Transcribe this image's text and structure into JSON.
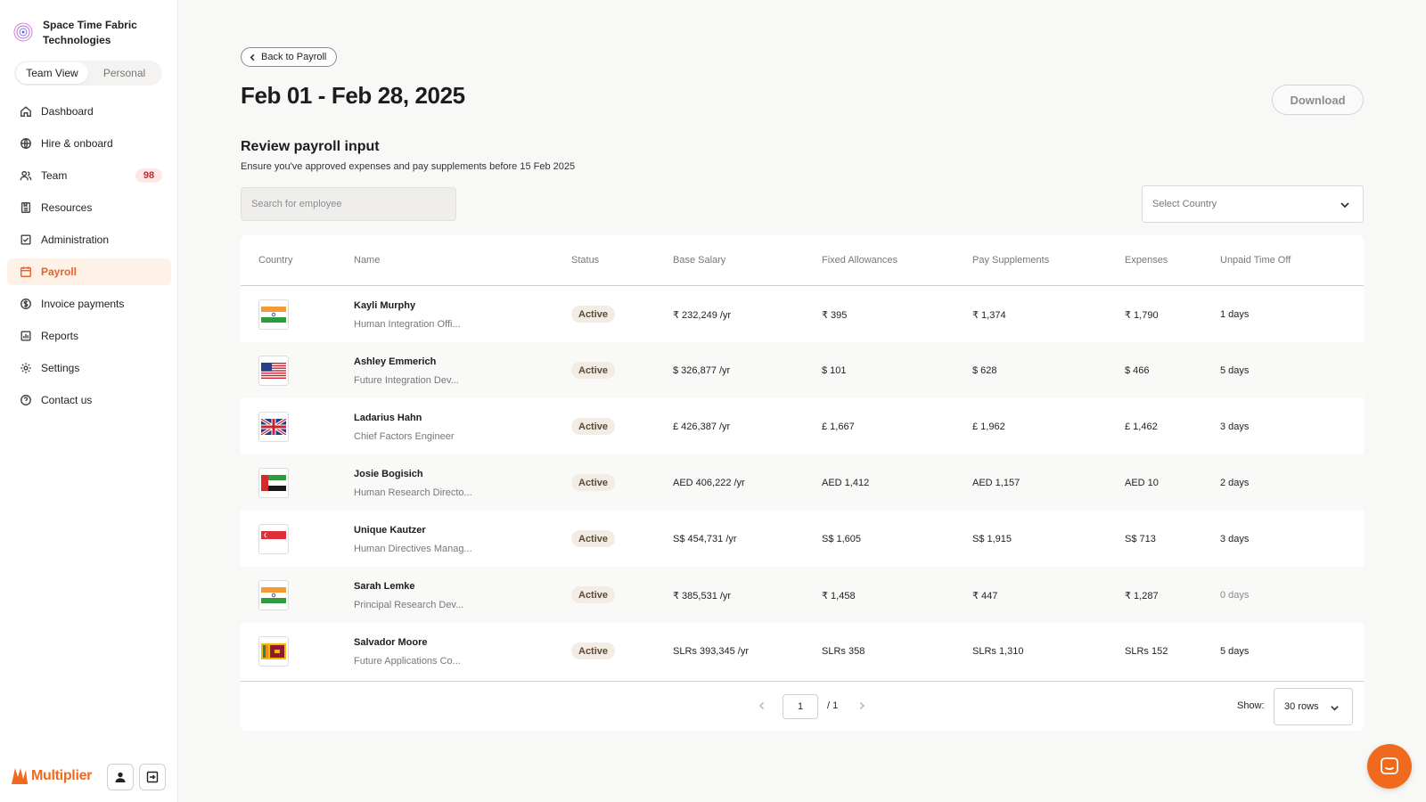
{
  "org": {
    "name": "Space Time Fabric Technologies"
  },
  "view_toggle": {
    "team": "Team View",
    "personal": "Personal"
  },
  "nav": [
    {
      "label": "Dashboard",
      "icon": "home-icon"
    },
    {
      "label": "Hire & onboard",
      "icon": "globe-icon"
    },
    {
      "label": "Team",
      "icon": "users-icon",
      "badge": "98"
    },
    {
      "label": "Resources",
      "icon": "resources-icon"
    },
    {
      "label": "Administration",
      "icon": "checklist-icon"
    },
    {
      "label": "Payroll",
      "icon": "calendar-icon",
      "active": true
    },
    {
      "label": "Invoice payments",
      "icon": "dollar-circle-icon"
    },
    {
      "label": "Reports",
      "icon": "reports-icon"
    },
    {
      "label": "Settings",
      "icon": "gear-icon"
    },
    {
      "label": "Contact us",
      "icon": "help-icon"
    }
  ],
  "brand": "Multiplier",
  "header": {
    "back_label": "Back to Payroll",
    "title": "Feb 01 - Feb 28, 2025",
    "download_label": "Download"
  },
  "section": {
    "title": "Review payroll input",
    "subtitle": "Ensure you've approved expenses and pay supplements before 15 Feb 2025"
  },
  "search": {
    "placeholder": "Search for employee"
  },
  "country_select": {
    "placeholder": "Select Country"
  },
  "table": {
    "columns": [
      "Country",
      "Name",
      "Status",
      "Base Salary",
      "Fixed Allowances",
      "Pay Supplements",
      "Expenses",
      "Unpaid Time Off"
    ],
    "rows": [
      {
        "flag": "india-flag-icon",
        "name": "Kayli Murphy",
        "role": "Human Integration Offi...",
        "status": "Active",
        "base": "₹ 232,249 /yr",
        "allow": "₹ 395",
        "supp": "₹ 1,374",
        "exp": "₹ 1,790",
        "uto": "1 days"
      },
      {
        "flag": "usa-flag-icon",
        "name": "Ashley Emmerich",
        "role": "Future Integration Dev...",
        "status": "Active",
        "base": "$ 326,877 /yr",
        "allow": "$ 101",
        "supp": "$ 628",
        "exp": "$ 466",
        "uto": "5 days"
      },
      {
        "flag": "uk-flag-icon",
        "name": "Ladarius Hahn",
        "role": "Chief Factors Engineer",
        "status": "Active",
        "base": "£ 426,387 /yr",
        "allow": "£ 1,667",
        "supp": "£ 1,962",
        "exp": "£ 1,462",
        "uto": "3 days"
      },
      {
        "flag": "uae-flag-icon",
        "name": "Josie Bogisich",
        "role": "Human Research Directo...",
        "status": "Active",
        "base": "AED 406,222 /yr",
        "allow": "AED 1,412",
        "supp": "AED 1,157",
        "exp": "AED 10",
        "uto": "2 days"
      },
      {
        "flag": "singapore-flag-icon",
        "name": "Unique Kautzer",
        "role": "Human Directives Manag...",
        "status": "Active",
        "base": "S$ 454,731 /yr",
        "allow": "S$ 1,605",
        "supp": "S$ 1,915",
        "exp": "S$ 713",
        "uto": "3 days"
      },
      {
        "flag": "india-flag-icon",
        "name": "Sarah Lemke",
        "role": "Principal Research Dev...",
        "status": "Active",
        "base": "₹ 385,531 /yr",
        "allow": "₹ 1,458",
        "supp": "₹ 447",
        "exp": "₹ 1,287",
        "uto": "0 days",
        "uto_muted": true
      },
      {
        "flag": "sri-lanka-flag-icon",
        "name": "Salvador Moore",
        "role": "Future Applications Co...",
        "status": "Active",
        "base": "SLRs 393,345 /yr",
        "allow": "SLRs 358",
        "supp": "SLRs 1,310",
        "exp": "SLRs 152",
        "uto": "5 days"
      }
    ]
  },
  "pagination": {
    "page": "1",
    "total": "/ 1",
    "show_label": "Show:",
    "rows_option": "30 rows"
  },
  "colors": {
    "accent": "#f06a1e",
    "active_nav_bg": "#fdf1e8",
    "badge_text": "#c62828"
  }
}
